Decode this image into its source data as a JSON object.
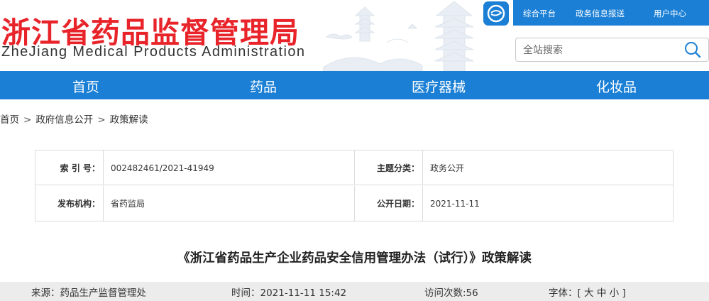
{
  "header": {
    "title_cn": "浙江省药品监督管理局",
    "title_en": "ZheJiang Medical Products Administration",
    "top_links": [
      "综合平台",
      "政务信息报送",
      "用户中心"
    ],
    "search_placeholder": "全站搜索"
  },
  "nav": {
    "items": [
      "首页",
      "药品",
      "医疗器械",
      "化妆品"
    ]
  },
  "breadcrumb": {
    "items": [
      "首页",
      "政府信息公开",
      "政策解读"
    ],
    "separator": ">"
  },
  "info_table": {
    "index_label": "索 引 号：",
    "index_value": "002482461/2021-41949",
    "topic_label": "主题分类：",
    "topic_value": "政务公开",
    "publisher_label": "发布机构：",
    "publisher_value": "省药监局",
    "date_label": "公开日期：",
    "date_value": "2021-11-11"
  },
  "article": {
    "title": "《浙江省药品生产企业药品安全信用管理办法（试行）》政策解读",
    "source": "来源：药品生产监督管理处",
    "time": "时间：2021-11-11 15:42",
    "visits": "访问次数:56",
    "font_size": "字体：[ 大 中 小 ]"
  },
  "colors": {
    "brand_blue": "#1a7fd5",
    "title_red": "#e8242a"
  }
}
